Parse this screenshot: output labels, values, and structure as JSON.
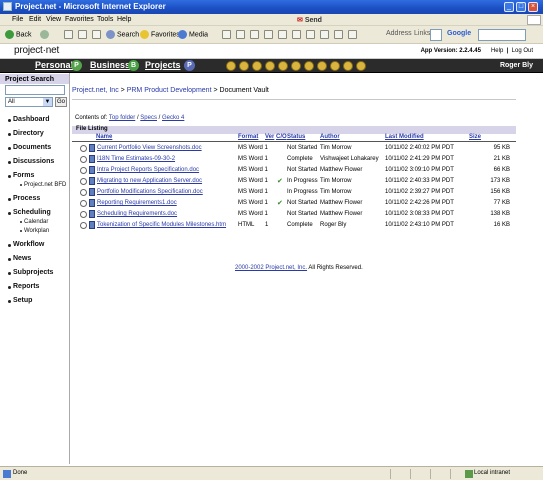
{
  "window": {
    "title": "Project.net - Microsoft Internet Explorer"
  },
  "menu": [
    "File",
    "Edit",
    "View",
    "Favorites",
    "Tools",
    "Help"
  ],
  "send_label": "Send",
  "toolbar": {
    "back": "Back",
    "search": "Search",
    "favorites": "Favorites",
    "media": "Media",
    "address": "Address",
    "links": "Links",
    "google": "Google"
  },
  "app": {
    "logo": "project·net",
    "version": "App Version: 2.2.4.45",
    "help": "Help",
    "logout": "Log Out",
    "user": "Roger Bly",
    "tabs": [
      {
        "label": "Personal",
        "icon": "P"
      },
      {
        "label": "Business",
        "icon": "B"
      },
      {
        "label": "Projects",
        "icon": "P"
      }
    ]
  },
  "sidebar": {
    "search_title": "Project Search",
    "select_value": "All",
    "go": "Go",
    "items": [
      {
        "label": "Dashboard"
      },
      {
        "label": "Directory"
      },
      {
        "label": "Documents"
      },
      {
        "label": "Discussions"
      },
      {
        "label": "Forms"
      },
      {
        "label": "Project.net BFD",
        "sub": true
      },
      {
        "label": "Process"
      },
      {
        "label": "Scheduling"
      },
      {
        "label": "Calendar",
        "sub": true
      },
      {
        "label": "Workplan",
        "sub": true
      },
      {
        "label": "Workflow"
      },
      {
        "label": "News"
      },
      {
        "label": "Subprojects"
      },
      {
        "label": "Reports"
      },
      {
        "label": "Setup"
      }
    ]
  },
  "breadcrumb": {
    "a": "Project.net, Inc",
    "sep": ">",
    "b": "PRM Product Development",
    "c": "Document Vault"
  },
  "contents": {
    "label": "Contents of:",
    "top": "Top folder",
    "specs": "Specs",
    "gecko": "Gecko 4"
  },
  "file_listing": {
    "title": "File Listing",
    "columns": {
      "name": "Name",
      "format": "Format",
      "ver": "Ver",
      "co": "C/O",
      "status": "Status",
      "author": "Author",
      "modified": "Last Modified",
      "size": "Size"
    },
    "rows": [
      {
        "name": "Current Portfolio View Screenshots.doc",
        "format": "MS Word 1",
        "ver": "",
        "checked": false,
        "status": "Not Started",
        "author": "Tim Morrow",
        "modified": "10/11/02 2:40:02 PM PDT",
        "size": "95 KB"
      },
      {
        "name": "I18N Time Estimates-09-30-2",
        "format": "MS Word 1",
        "ver": "",
        "checked": false,
        "status": "Complete",
        "author": "Vishwajeet Lohakarey",
        "modified": "10/11/02 2:41:29 PM PDT",
        "size": "21 KB"
      },
      {
        "name": "Intra Project Reports Specification.doc",
        "format": "MS Word 1",
        "ver": "",
        "checked": false,
        "status": "Not Started",
        "author": "Matthew Flower",
        "modified": "10/11/02 3:09:10 PM PDT",
        "size": "66 KB"
      },
      {
        "name": "Migrating to new Application Server.doc",
        "format": "MS Word 1",
        "ver": "",
        "checked": true,
        "status": "In Progress",
        "author": "Tim Morrow",
        "modified": "10/11/02 2:40:33 PM PDT",
        "size": "173 KB"
      },
      {
        "name": "Portfolio Modifications Specification.doc",
        "format": "MS Word 1",
        "ver": "",
        "checked": false,
        "status": "In Progress",
        "author": "Tim Morrow",
        "modified": "10/11/02 2:39:27 PM PDT",
        "size": "156 KB"
      },
      {
        "name": "Reporting Requirements1.doc",
        "format": "MS Word 1",
        "ver": "",
        "checked": true,
        "status": "Not Started",
        "author": "Matthew Flower",
        "modified": "10/11/02 2:42:26 PM PDT",
        "size": "77 KB"
      },
      {
        "name": "Scheduling Requirements.doc",
        "format": "MS Word 1",
        "ver": "",
        "checked": false,
        "status": "Not Started",
        "author": "Matthew Flower",
        "modified": "10/11/02 3:08:33 PM PDT",
        "size": "138 KB"
      },
      {
        "name": "Tokenization of Specific Modules Milestones.htm",
        "format": "HTML",
        "ver": "1",
        "checked": false,
        "status": "Complete",
        "author": "Roger Bly",
        "modified": "10/11/02 2:43:10 PM PDT",
        "size": "16 KB"
      }
    ]
  },
  "footer": {
    "copyright": "2000-2002 Project.net, Inc.",
    "rights": "All Rights Reserved."
  },
  "statusbar": {
    "left": "Done",
    "zone": "Local intranet"
  },
  "colors": {
    "titlebar": "#1b4fc4",
    "link": "#2a3aa8",
    "nav_bg": "#2b2b2b",
    "header_band": "#d7d4ea"
  }
}
